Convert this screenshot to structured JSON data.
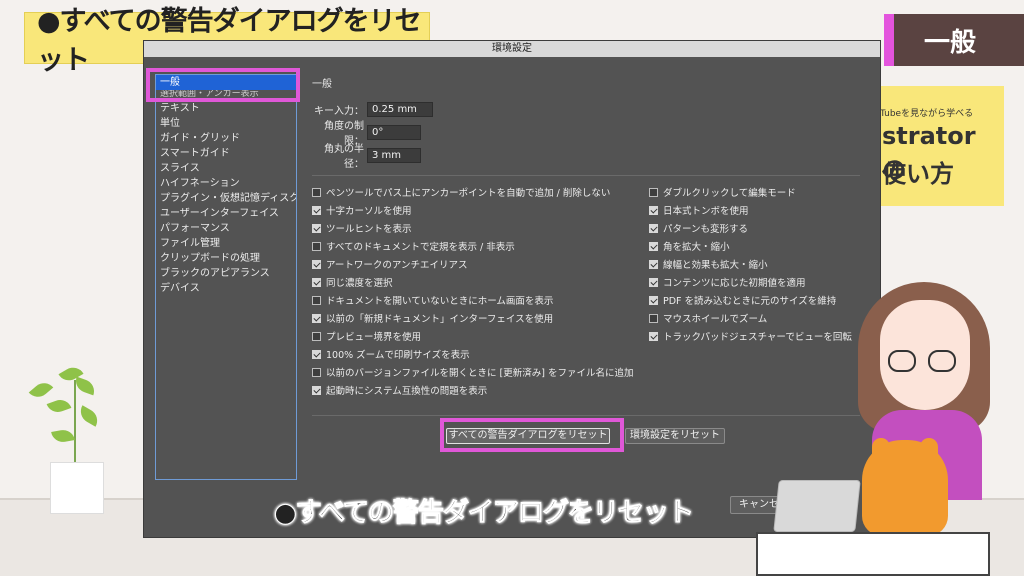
{
  "overlay": {
    "title_banner": "●すべての警告ダイアログをリセット",
    "section_tag": "一般",
    "book_sub": "Tubeを見ながら学べる",
    "book_main1": "strator の",
    "book_main2": "使い方",
    "subtitle": "●すべての警告ダイアログをリセット"
  },
  "dialog": {
    "title": "環境設定",
    "sidebar": {
      "items": [
        "一般",
        "選択範囲・アンカー表示",
        "テキスト",
        "単位",
        "ガイド・グリッド",
        "スマートガイド",
        "スライス",
        "ハイフネーション",
        "プラグイン・仮想記憶ディスク",
        "ユーザーインターフェイス",
        "パフォーマンス",
        "ファイル管理",
        "クリップボードの処理",
        "ブラックのアピアランス",
        "デバイス"
      ]
    },
    "pane_title": "一般",
    "fields": {
      "key_input_label": "キー入力：",
      "key_input_value": "0.25 mm",
      "angle_label": "角度の制限：",
      "angle_value": "0°",
      "radius_label": "角丸の半径：",
      "radius_value": "3 mm"
    },
    "checkboxes_left": [
      {
        "label": "ペンツールでパス上にアンカーポイントを自動で追加 / 削除しない",
        "checked": false
      },
      {
        "label": "十字カーソルを使用",
        "checked": true
      },
      {
        "label": "ツールヒントを表示",
        "checked": true
      },
      {
        "label": "すべてのドキュメントで定規を表示 / 非表示",
        "checked": false
      },
      {
        "label": "アートワークのアンチエイリアス",
        "checked": true
      },
      {
        "label": "同じ濃度を選択",
        "checked": true
      },
      {
        "label": "ドキュメントを開いていないときにホーム画面を表示",
        "checked": false
      },
      {
        "label": "以前の「新規ドキュメント」インターフェイスを使用",
        "checked": true
      },
      {
        "label": "プレビュー境界を使用",
        "checked": false
      },
      {
        "label": "100% ズームで印刷サイズを表示",
        "checked": true
      },
      {
        "label": "以前のバージョンファイルを開くときに [更新済み] をファイル名に追加",
        "checked": false
      },
      {
        "label": "起動時にシステム互換性の問題を表示",
        "checked": true
      }
    ],
    "checkboxes_right": [
      {
        "label": "ダブルクリックして編集モード",
        "checked": false
      },
      {
        "label": "日本式トンボを使用",
        "checked": true
      },
      {
        "label": "パターンも変形する",
        "checked": true
      },
      {
        "label": "角を拡大・縮小",
        "checked": true
      },
      {
        "label": "線幅と効果も拡大・縮小",
        "checked": true
      },
      {
        "label": "コンテンツに応じた初期値を適用",
        "checked": true
      },
      {
        "label": "PDF を読み込むときに元のサイズを維持",
        "checked": true
      },
      {
        "label": "マウスホイールでズーム",
        "checked": false
      },
      {
        "label": "トラックパッドジェスチャーでビューを回転",
        "checked": true
      }
    ],
    "buttons": {
      "reset_warnings": "すべての警告ダイアログをリセット",
      "reset_prefs": "環境設定をリセット",
      "cancel": "キャンセル"
    }
  },
  "colors": {
    "highlight": "#e058d8",
    "banner_yellow": "#f9e77a",
    "dialog_bg": "#535353",
    "selection_blue": "#1f63d6"
  }
}
